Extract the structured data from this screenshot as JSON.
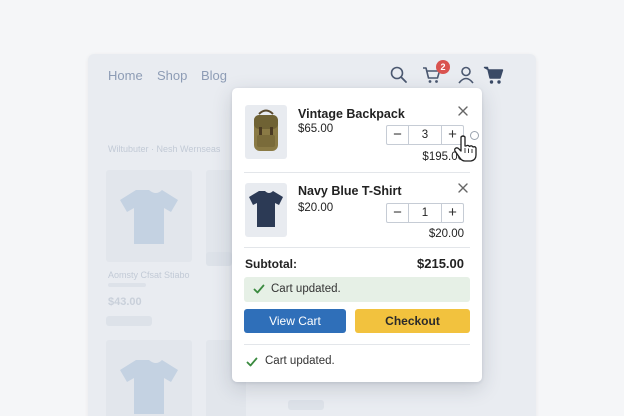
{
  "nav": {
    "links": [
      "Home",
      "Shop",
      "Blog"
    ],
    "cart_count": "2"
  },
  "background": {
    "breadcrumb": "Wiltubuter · Nesh Wernseas",
    "product_label": "Aomsty Cfsat Stiabo",
    "product_price": "$43.00"
  },
  "cart": {
    "items": [
      {
        "name": "Vintage Backpack",
        "price": "$65.00",
        "qty": "3",
        "line_total": "$195.00"
      },
      {
        "name": "Navy Blue T-Shirt",
        "price": "$20.00",
        "qty": "1",
        "line_total": "$20.00"
      }
    ],
    "subtotal_label": "Subtotal:",
    "subtotal_value": "$215.00",
    "notice": "Cart updated.",
    "view_cart_label": "View Cart",
    "checkout_label": "Checkout",
    "footer_notice": "Cart updated."
  },
  "colors": {
    "primary": "#2f6fb9",
    "accent": "#f2c23e",
    "success": "#3a8a3f",
    "badge": "#d9534f"
  }
}
